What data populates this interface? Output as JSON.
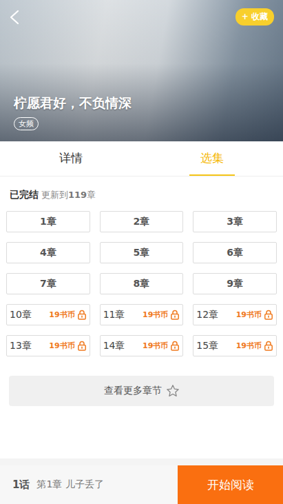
{
  "header": {
    "collect_button": "+ 收藏"
  },
  "book": {
    "title": "柠愿君好，不负情深",
    "tag": "女频"
  },
  "tabs": [
    {
      "label": "详情",
      "selected": false
    },
    {
      "label": "选集",
      "selected": true
    }
  ],
  "status": {
    "state": "已完结",
    "update_prefix": "更新到",
    "update_count": "119",
    "update_suffix": "章"
  },
  "chapters": [
    {
      "label": "1章",
      "locked": false
    },
    {
      "label": "2章",
      "locked": false
    },
    {
      "label": "3章",
      "locked": false
    },
    {
      "label": "4章",
      "locked": false
    },
    {
      "label": "5章",
      "locked": false
    },
    {
      "label": "6章",
      "locked": false
    },
    {
      "label": "7章",
      "locked": false
    },
    {
      "label": "8章",
      "locked": false
    },
    {
      "label": "9章",
      "locked": false
    },
    {
      "label": "10章",
      "locked": true,
      "price": "19书币"
    },
    {
      "label": "11章",
      "locked": true,
      "price": "19书币"
    },
    {
      "label": "12章",
      "locked": true,
      "price": "19书币"
    },
    {
      "label": "13章",
      "locked": true,
      "price": "19书币"
    },
    {
      "label": "14章",
      "locked": true,
      "price": "19书币"
    },
    {
      "label": "15章",
      "locked": true,
      "price": "19书币"
    }
  ],
  "more_button": "查看更多章节",
  "bottom_bar": {
    "episode": "1话",
    "chapter": "第1章 儿子丢了",
    "read_button": "开始阅读"
  }
}
